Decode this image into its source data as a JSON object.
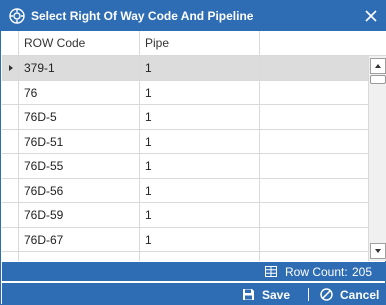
{
  "window": {
    "title": "Select Right Of Way Code And Pipeline",
    "title_icon": "gear-icon",
    "close_icon": "close-icon"
  },
  "grid": {
    "columns": [
      "ROW Code",
      "Pipe"
    ],
    "rows": [
      {
        "row_code": "379-1",
        "pipe": "1",
        "selected": true
      },
      {
        "row_code": "76",
        "pipe": "1"
      },
      {
        "row_code": "76D-5",
        "pipe": "1"
      },
      {
        "row_code": "76D-51",
        "pipe": "1"
      },
      {
        "row_code": "76D-55",
        "pipe": "1"
      },
      {
        "row_code": "76D-56",
        "pipe": "1"
      },
      {
        "row_code": "76D-59",
        "pipe": "1"
      },
      {
        "row_code": "76D-67",
        "pipe": "1"
      },
      {
        "row_code": "",
        "pipe": ""
      }
    ]
  },
  "status": {
    "row_count_label": "Row Count:",
    "row_count_value": "205",
    "icon": "table-icon"
  },
  "footer": {
    "save_label": "Save",
    "save_icon": "save-icon",
    "cancel_label": "Cancel",
    "cancel_icon": "cancel-icon"
  },
  "colors": {
    "accent": "#2e6db4",
    "selected_row": "#dcdcdc",
    "grid_line": "#d9d9d9"
  }
}
